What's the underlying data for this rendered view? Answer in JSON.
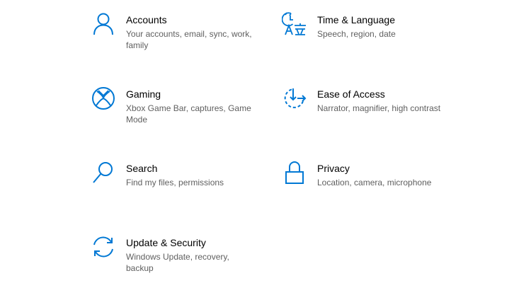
{
  "accent_color": "#0078d4",
  "tiles": [
    {
      "title": "Accounts",
      "desc": "Your accounts, email, sync, work, family",
      "icon": "person-icon"
    },
    {
      "title": "Time & Language",
      "desc": "Speech, region, date",
      "icon": "time-language-icon"
    },
    {
      "title": "Gaming",
      "desc": "Xbox Game Bar, captures, Game Mode",
      "icon": "xbox-icon"
    },
    {
      "title": "Ease of Access",
      "desc": "Narrator, magnifier, high contrast",
      "icon": "ease-of-access-icon"
    },
    {
      "title": "Search",
      "desc": "Find my files, permissions",
      "icon": "magnifier-icon"
    },
    {
      "title": "Privacy",
      "desc": "Location, camera, microphone",
      "icon": "lock-icon"
    },
    {
      "title": "Update & Security",
      "desc": "Windows Update, recovery, backup",
      "icon": "sync-icon"
    }
  ]
}
